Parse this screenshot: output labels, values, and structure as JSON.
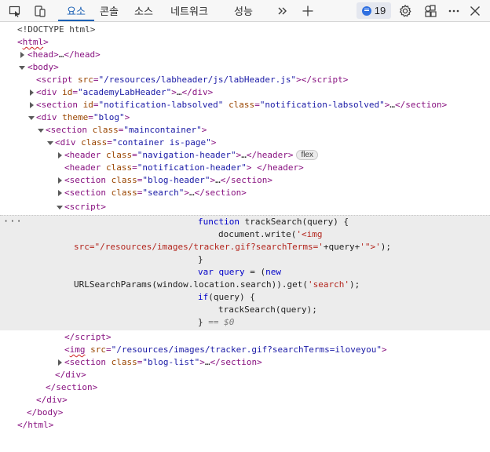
{
  "toolbar": {
    "tabs": [
      "요소",
      "콘솔",
      "소스",
      "네트워크",
      "성능"
    ],
    "active_tab": "요소",
    "issues_count": "19",
    "icons": [
      "inspect-icon",
      "device-emulation-icon",
      "more-tabs-icon",
      "add-tab-icon",
      "issues-icon",
      "settings-icon",
      "connected-devices-icon",
      "more-options-icon",
      "close-icon"
    ]
  },
  "dom": {
    "doctype": "<!DOCTYPE html>",
    "html_open": "html",
    "head": {
      "tag": "head",
      "ellipsis": "…",
      "close": "head"
    },
    "body_open": "body",
    "script_labheader": {
      "tag": "script",
      "attr": "src",
      "value": "\"/resources/labheader/js/labHeader.js\""
    },
    "div_academy": {
      "tag": "div",
      "attr": "id",
      "value": "\"academyLabHeader\""
    },
    "section_notification": {
      "tag": "section",
      "attr1": "id",
      "value1": "\"notification-labsolved\"",
      "attr2": "class",
      "value2": "\"notification-labsolved\""
    },
    "div_theme": {
      "tag": "div",
      "attr": "theme",
      "value": "\"blog\""
    },
    "section_main": {
      "tag": "section",
      "attr": "class",
      "value": "\"maincontainer\""
    },
    "div_container": {
      "tag": "div",
      "attr": "class",
      "value": "\"container is-page\""
    },
    "header_nav": {
      "tag": "header",
      "attr": "class",
      "value": "\"navigation-header\"",
      "badge": "flex"
    },
    "header_notif": {
      "tag": "header",
      "attr": "class",
      "value": "\"notification-header\""
    },
    "section_blog_header": {
      "tag": "section",
      "attr": "class",
      "value": "\"blog-header\""
    },
    "section_search": {
      "tag": "section",
      "attr": "class",
      "value": "\"search\""
    },
    "script_open": "script",
    "script_lines": {
      "l1_kw": "function",
      "l1_name": "trackSearch",
      "l1_rest": "(query) {",
      "l2_a": "document.write(",
      "l2_str": "'<img",
      "l3_str": "src=\"/resources/images/tracker.gif?searchTerms='",
      "l3_mid": "+query+",
      "l3_str2": "'\">'",
      "l3_end": ");",
      "l4": "}",
      "l5_kw": "var",
      "l5_a": "query",
      "l5_b": " = (",
      "l5_kw2": "new",
      "l6_a": "URLSearchParams(window.location.search)).get(",
      "l6_str": "'search'",
      "l6_end": ");",
      "l7_kw": "if",
      "l7_rest": "(query) {",
      "l8": "trackSearch(query);",
      "l9": "}",
      "l9_eq": "== $0"
    },
    "script_close": "script",
    "img_tracker": {
      "tag": "img",
      "attr": "src",
      "value": "\"/resources/images/tracker.gif?searchTerms=iloveyou\""
    },
    "section_blog_list": {
      "tag": "section",
      "attr": "class",
      "value": "\"blog-list\""
    },
    "div_close": "div",
    "section_close": "section",
    "div_close2": "div",
    "body_close": "body",
    "html_close": "html",
    "ellipsis_menu": "···"
  }
}
